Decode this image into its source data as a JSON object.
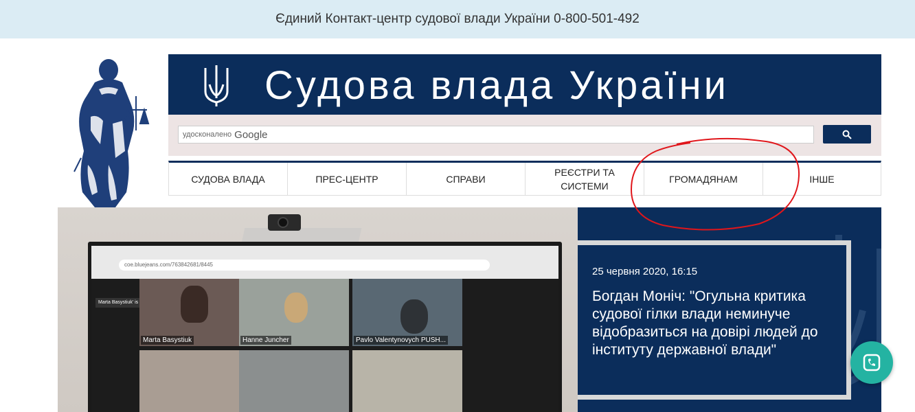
{
  "topbar": {
    "contact_text": "Єдиний Контакт-центр судової влади України 0-800-501-492"
  },
  "header": {
    "site_title": "Судова влада України"
  },
  "search": {
    "prefix": "удосконалено",
    "brand": "Google",
    "button_icon": "search-icon"
  },
  "nav": {
    "items": [
      {
        "label": "СУДОВА ВЛАДА"
      },
      {
        "label": "ПРЕС-ЦЕНТР"
      },
      {
        "label": "СПРАВИ"
      },
      {
        "label": "РЕЄСТРИ ТА СИСТЕМИ"
      },
      {
        "label": "ГРОМАДЯНАМ"
      },
      {
        "label": "ІНШЕ"
      }
    ]
  },
  "hero": {
    "date": "25 червня 2020, 16:15",
    "headline": "Богдан Моніч: \"Огульна критика судової гілки влади неминуче відобразиться на довірі людей до інституту державної влади\"",
    "photo": {
      "url_text": "coe.bluejeans.com/763842681/8445",
      "talking": "Marta Basystiuk' is talking",
      "participants": [
        {
          "name": "Marta Basystiuk"
        },
        {
          "name": "Hanne Juncher"
        },
        {
          "name": "Pavlo Valentynovych PUSH..."
        }
      ]
    }
  },
  "colors": {
    "navy": "#0b2d5b",
    "topbar": "#dbecf4",
    "chat": "#24b3a2",
    "annotation": "#e0161b"
  },
  "chat": {
    "icon": "phone-icon"
  }
}
